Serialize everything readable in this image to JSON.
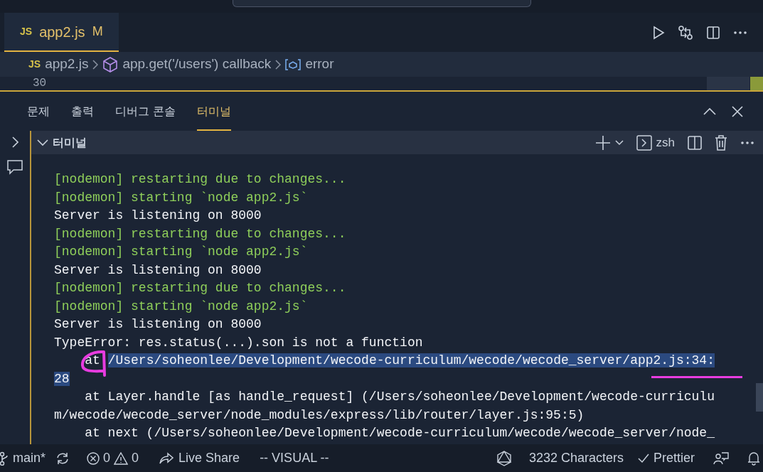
{
  "editor_tabs": [
    {
      "icon": "JS",
      "label": "app2.js",
      "badge": "M",
      "selected": true
    }
  ],
  "breadcrumb": [
    {
      "kind": "file",
      "icon": "JS",
      "label": "app2.js"
    },
    {
      "kind": "method",
      "label": "app.get('/users') callback"
    },
    {
      "kind": "variable",
      "label": "error"
    }
  ],
  "line_number": "30",
  "panel_tabs": [
    {
      "label": "문제",
      "selected": false
    },
    {
      "label": "출력",
      "selected": false
    },
    {
      "label": "디버그 콘솔",
      "selected": false
    },
    {
      "label": "터미널",
      "selected": true
    }
  ],
  "terminal": {
    "title": "터미널",
    "shell": "zsh",
    "lines": [
      {
        "kind": "nodemon",
        "segments": [
          {
            "text": "[nodemon] restarting due to changes...",
            "selected": false
          }
        ]
      },
      {
        "kind": "nodemon",
        "segments": [
          {
            "text": "[nodemon] starting `node app2.js`",
            "selected": false
          }
        ]
      },
      {
        "kind": "output",
        "segments": [
          {
            "text": "Server is listening on 8000",
            "selected": false
          }
        ]
      },
      {
        "kind": "nodemon",
        "segments": [
          {
            "text": "[nodemon] restarting due to changes...",
            "selected": false
          }
        ]
      },
      {
        "kind": "nodemon",
        "segments": [
          {
            "text": "[nodemon] starting `node app2.js`",
            "selected": false
          }
        ]
      },
      {
        "kind": "output",
        "segments": [
          {
            "text": "Server is listening on 8000",
            "selected": false
          }
        ]
      },
      {
        "kind": "nodemon",
        "segments": [
          {
            "text": "[nodemon] restarting due to changes...",
            "selected": false
          }
        ]
      },
      {
        "kind": "nodemon",
        "segments": [
          {
            "text": "[nodemon] starting `node app2.js`",
            "selected": false
          }
        ]
      },
      {
        "kind": "output",
        "segments": [
          {
            "text": "Server is listening on 8000",
            "selected": false
          }
        ]
      },
      {
        "kind": "output",
        "segments": [
          {
            "text": "TypeError: res.status(...).son is not a function",
            "selected": false
          }
        ]
      },
      {
        "kind": "output",
        "segments": [
          {
            "text": "    at ",
            "selected": false
          },
          {
            "text": "/Users/soheonlee/Development/wecode-curriculum/wecode/wecode_server/app2.js:34:",
            "selected": true
          }
        ]
      },
      {
        "kind": "output",
        "segments": [
          {
            "text": "28",
            "selected": true
          }
        ]
      },
      {
        "kind": "output",
        "segments": [
          {
            "text": "    at Layer.handle [as handle_request] (/Users/soheonlee/Development/wecode-curriculu",
            "selected": false
          }
        ]
      },
      {
        "kind": "output",
        "segments": [
          {
            "text": "m/wecode/wecode_server/node_modules/express/lib/router/layer.js:95:5)",
            "selected": false
          }
        ]
      },
      {
        "kind": "output",
        "segments": [
          {
            "text": "    at next (/Users/soheonlee/Development/wecode-curriculum/wecode/wecode_server/node_",
            "selected": false
          }
        ]
      }
    ]
  },
  "status_bar": {
    "branch": "main*",
    "errors": "0",
    "warnings": "0",
    "live_share": "Live Share",
    "mode": "-- VISUAL --",
    "characters": "3232 Characters",
    "formatter": "Prettier"
  }
}
